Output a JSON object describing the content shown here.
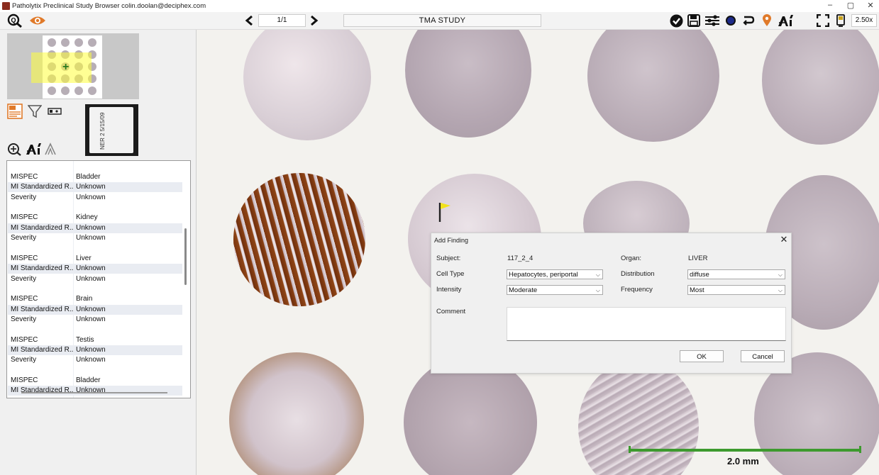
{
  "window": {
    "title": "Patholytix Preclinical Study Browser  colin.doolan@deciphex.com",
    "controls": {
      "minimize": "–",
      "restore": "▢",
      "close": "✕"
    }
  },
  "toolbar": {
    "page": "1/1",
    "study_title": "TMA STUDY",
    "zoom": "2.50x"
  },
  "findings": [
    {
      "k": "MISPEC",
      "v": "Bladder"
    },
    {
      "k": "MI Standardized R...",
      "v": "Unknown"
    },
    {
      "k": "Severity",
      "v": "Unknown"
    },
    {
      "k": "MISPEC",
      "v": "Kidney"
    },
    {
      "k": "MI Standardized R...",
      "v": "Unknown"
    },
    {
      "k": "Severity",
      "v": "Unknown"
    },
    {
      "k": "MISPEC",
      "v": "Liver"
    },
    {
      "k": "MI Standardized R...",
      "v": "Unknown"
    },
    {
      "k": "Severity",
      "v": "Unknown"
    },
    {
      "k": "MISPEC",
      "v": "Brain"
    },
    {
      "k": "MI Standardized R...",
      "v": "Unknown"
    },
    {
      "k": "Severity",
      "v": "Unknown"
    },
    {
      "k": "MISPEC",
      "v": "Testis"
    },
    {
      "k": "MI Standardized R...",
      "v": "Unknown"
    },
    {
      "k": "Severity",
      "v": "Unknown"
    },
    {
      "k": "MISPEC",
      "v": "Bladder"
    },
    {
      "k": "MI Standardized R...",
      "v": "Unknown"
    }
  ],
  "slide_label": {
    "text": "NER 2  5/15/09"
  },
  "viewer": {
    "scale_label": "2.0 mm"
  },
  "dialog": {
    "title": "Add Finding",
    "subject_label": "Subject:",
    "subject_value": "117_2_4",
    "organ_label": "Organ:",
    "organ_value": "LIVER",
    "cell_type_label": "Cell Type",
    "cell_type_value": "Hepatocytes, periportal",
    "distribution_label": "Distribution",
    "distribution_value": "diffuse",
    "intensity_label": "Intensity",
    "intensity_value": "Moderate",
    "frequency_label": "Frequency",
    "frequency_value": "Most",
    "comment_label": "Comment",
    "comment_value": "",
    "ok_label": "OK",
    "cancel_label": "Cancel"
  }
}
